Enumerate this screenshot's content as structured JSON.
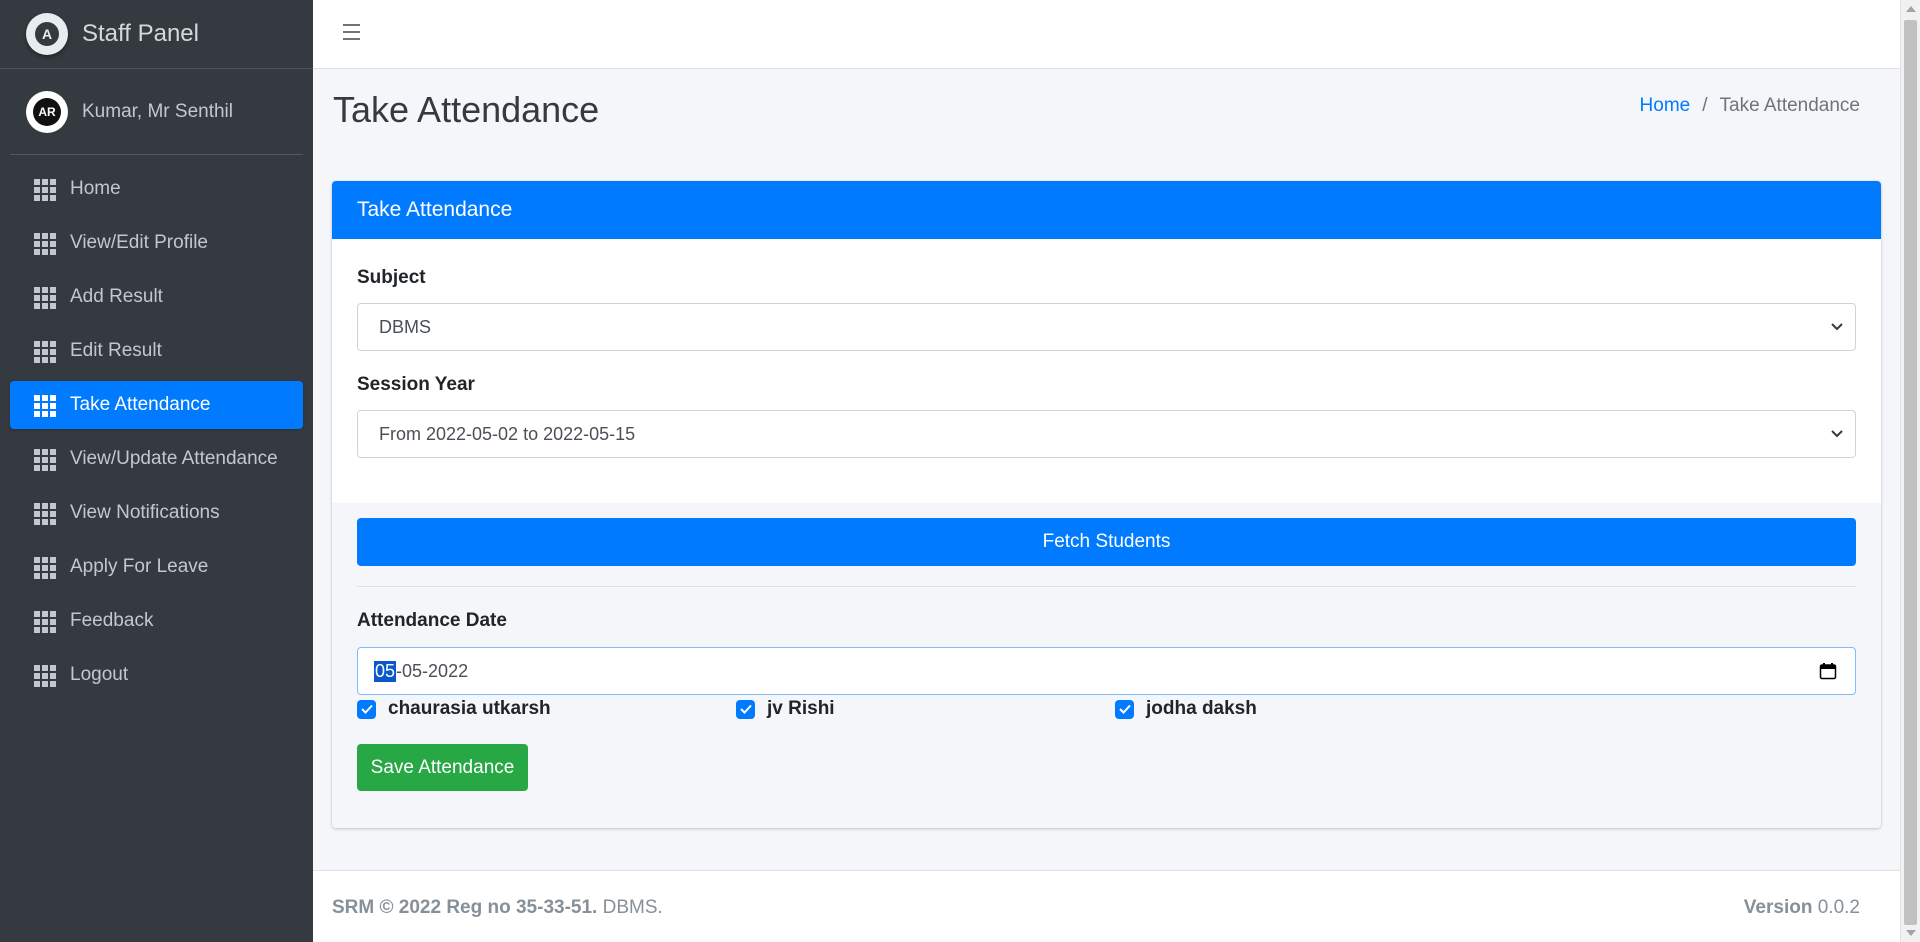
{
  "brand": {
    "title": "Staff Panel",
    "logo_letter": "A"
  },
  "user": {
    "name": "Kumar, Mr Senthil",
    "avatar_text": "AR"
  },
  "sidebar": {
    "items": [
      {
        "label": "Home",
        "icon": "grid-icon"
      },
      {
        "label": "View/Edit Profile",
        "icon": "grid-icon"
      },
      {
        "label": "Add Result",
        "icon": "grid-icon"
      },
      {
        "label": "Edit Result",
        "icon": "grid-icon"
      },
      {
        "label": "Take Attendance",
        "icon": "grid-icon",
        "active": true
      },
      {
        "label": "View/Update Attendance",
        "icon": "grid-icon"
      },
      {
        "label": "View Notifications",
        "icon": "grid-icon"
      },
      {
        "label": "Apply For Leave",
        "icon": "grid-icon"
      },
      {
        "label": "Feedback",
        "icon": "grid-icon"
      },
      {
        "label": "Logout",
        "icon": "grid-icon"
      }
    ]
  },
  "header": {
    "page_title": "Take Attendance",
    "breadcrumb": {
      "home": "Home",
      "separator": "/",
      "current": "Take Attendance"
    }
  },
  "card": {
    "title": "Take Attendance",
    "subject_label": "Subject",
    "subject_value": "DBMS",
    "session_label": "Session Year",
    "session_value": "From 2022-05-02 to 2022-05-15",
    "fetch_button": "Fetch Students",
    "date_label": "Attendance Date",
    "date_day": "05",
    "date_rest": "-05-2022",
    "students": [
      {
        "name": "chaurasia utkarsh",
        "checked": true
      },
      {
        "name": "jv Rishi",
        "checked": true
      },
      {
        "name": "jodha daksh",
        "checked": true
      }
    ],
    "save_button": "Save Attendance"
  },
  "footer": {
    "left_bold": "SRM © 2022 Reg no 35-33-51.",
    "left_rest": " DBMS.",
    "version_label": "Version",
    "version_value": " 0.0.2"
  },
  "colors": {
    "primary": "#007bff",
    "success": "#28a745",
    "sidebar_bg": "#343a40"
  }
}
